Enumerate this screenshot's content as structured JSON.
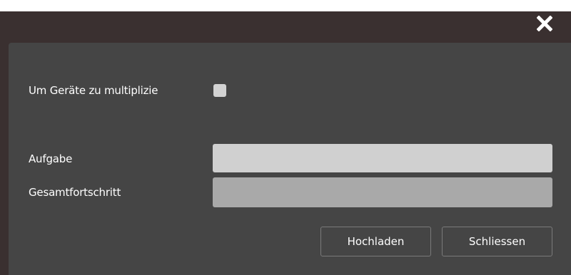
{
  "titlebar": {
    "close_icon": "close-icon"
  },
  "form": {
    "multiply_label": "Um Geräte zu multiplizie",
    "multiply_checked": false,
    "task_label": "Aufgabe",
    "task_value": "",
    "progress_label": "Gesamtfortschritt",
    "progress_value": 0
  },
  "buttons": {
    "upload_label": "Hochladen",
    "close_label": "Schliessen"
  },
  "colors": {
    "window_bg": "#3a3030",
    "panel_bg": "#454545",
    "text": "#ffffff"
  }
}
